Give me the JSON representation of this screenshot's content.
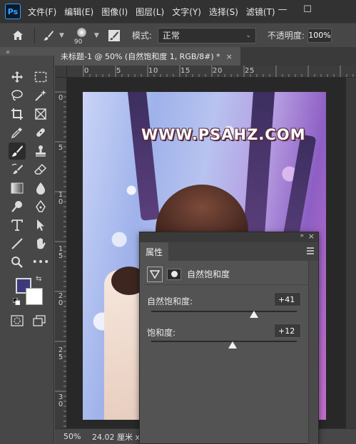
{
  "menubar": {
    "logo": "Ps",
    "items": [
      "文件(F)",
      "编辑(E)",
      "图像(I)",
      "图层(L)",
      "文字(Y)",
      "选择(S)",
      "滤镜(T)"
    ],
    "minimize": "—",
    "maximize": "☐"
  },
  "options": {
    "brush_size": "90",
    "mode_label": "模式:",
    "mode_value": "正常",
    "opacity_label": "不透明度:",
    "opacity_value": "100%"
  },
  "toolbox": {
    "collapse_glyph": "«",
    "foreground_color": "#3c3a7a",
    "background_color": "#ffffff"
  },
  "document": {
    "tab_title": "未标题-1 @ 50% (自然饱和度 1, RGB/8#) *",
    "tab_close": "×",
    "watermark": "WWW.PSAHZ.COM"
  },
  "rulers": {
    "top": [
      "0",
      "5",
      "1",
      "0",
      "1",
      "5",
      "2",
      "0",
      "2",
      "5"
    ],
    "left": [
      "0",
      "5",
      "1\n0",
      "1\n5",
      "2\n0",
      "2\n5",
      "3\n0"
    ]
  },
  "status": {
    "zoom": "50%",
    "doc_size": "24.02 厘米 x"
  },
  "properties": {
    "collapse": "»",
    "close": "×",
    "tab": "属性",
    "adjustment_title": "自然饱和度",
    "vibrance_label": "自然饱和度:",
    "vibrance_value": "+41",
    "vibrance_level": 41,
    "saturation_label": "饱和度:",
    "saturation_value": "+12",
    "saturation_level": 12
  }
}
